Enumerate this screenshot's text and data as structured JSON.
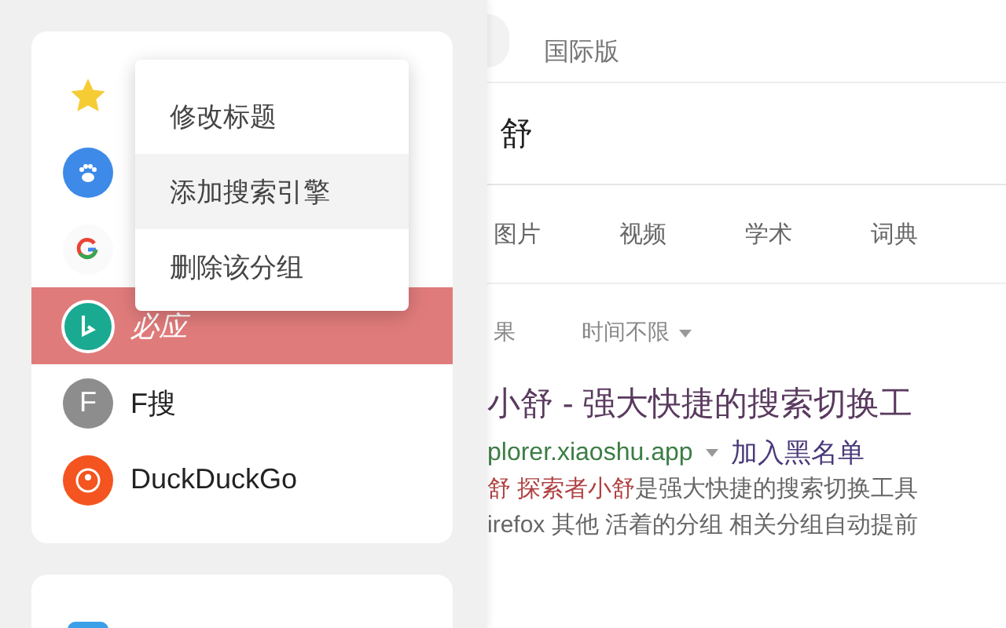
{
  "groups": [
    {
      "items": [
        {
          "kind": "star",
          "selected": false
        },
        {
          "kind": "paw",
          "selected": false
        },
        {
          "kind": "google",
          "selected": false
        },
        {
          "kind": "bing",
          "label": "必应",
          "selected": true
        },
        {
          "kind": "letter",
          "icon_text": "F",
          "label": "F搜",
          "selected": false
        },
        {
          "kind": "duck",
          "label": "DuckDuckGo",
          "selected": false
        }
      ]
    },
    {
      "items": [
        {
          "kind": "square"
        }
      ]
    }
  ],
  "context_menu": [
    {
      "label": "修改标题",
      "selected": false
    },
    {
      "label": "添加搜索引擎",
      "selected": true
    },
    {
      "label": "删除该分组",
      "selected": false
    }
  ],
  "page": {
    "edition": "国际版",
    "query": "舒",
    "tabs": [
      {
        "label": "图片"
      },
      {
        "label": "视频"
      },
      {
        "label": "学术"
      },
      {
        "label": "词典"
      }
    ],
    "filters": [
      {
        "label": "果",
        "dropdown": false
      },
      {
        "label": "时间不限",
        "dropdown": true
      }
    ],
    "result": {
      "title": "小舒 - 强大快捷的搜索切换工",
      "url": "plorer.xiaoshu.app",
      "blacklist": "加入黑名单",
      "snippet": [
        [
          {
            "text": "舒 探索者小舒",
            "highlight": true
          },
          {
            "text": "是强大快捷的搜索切换工具",
            "highlight": false
          }
        ],
        [
          {
            "text": "irefox 其他 活着的分组 相关分组自动提前",
            "highlight": false
          }
        ]
      ]
    }
  }
}
